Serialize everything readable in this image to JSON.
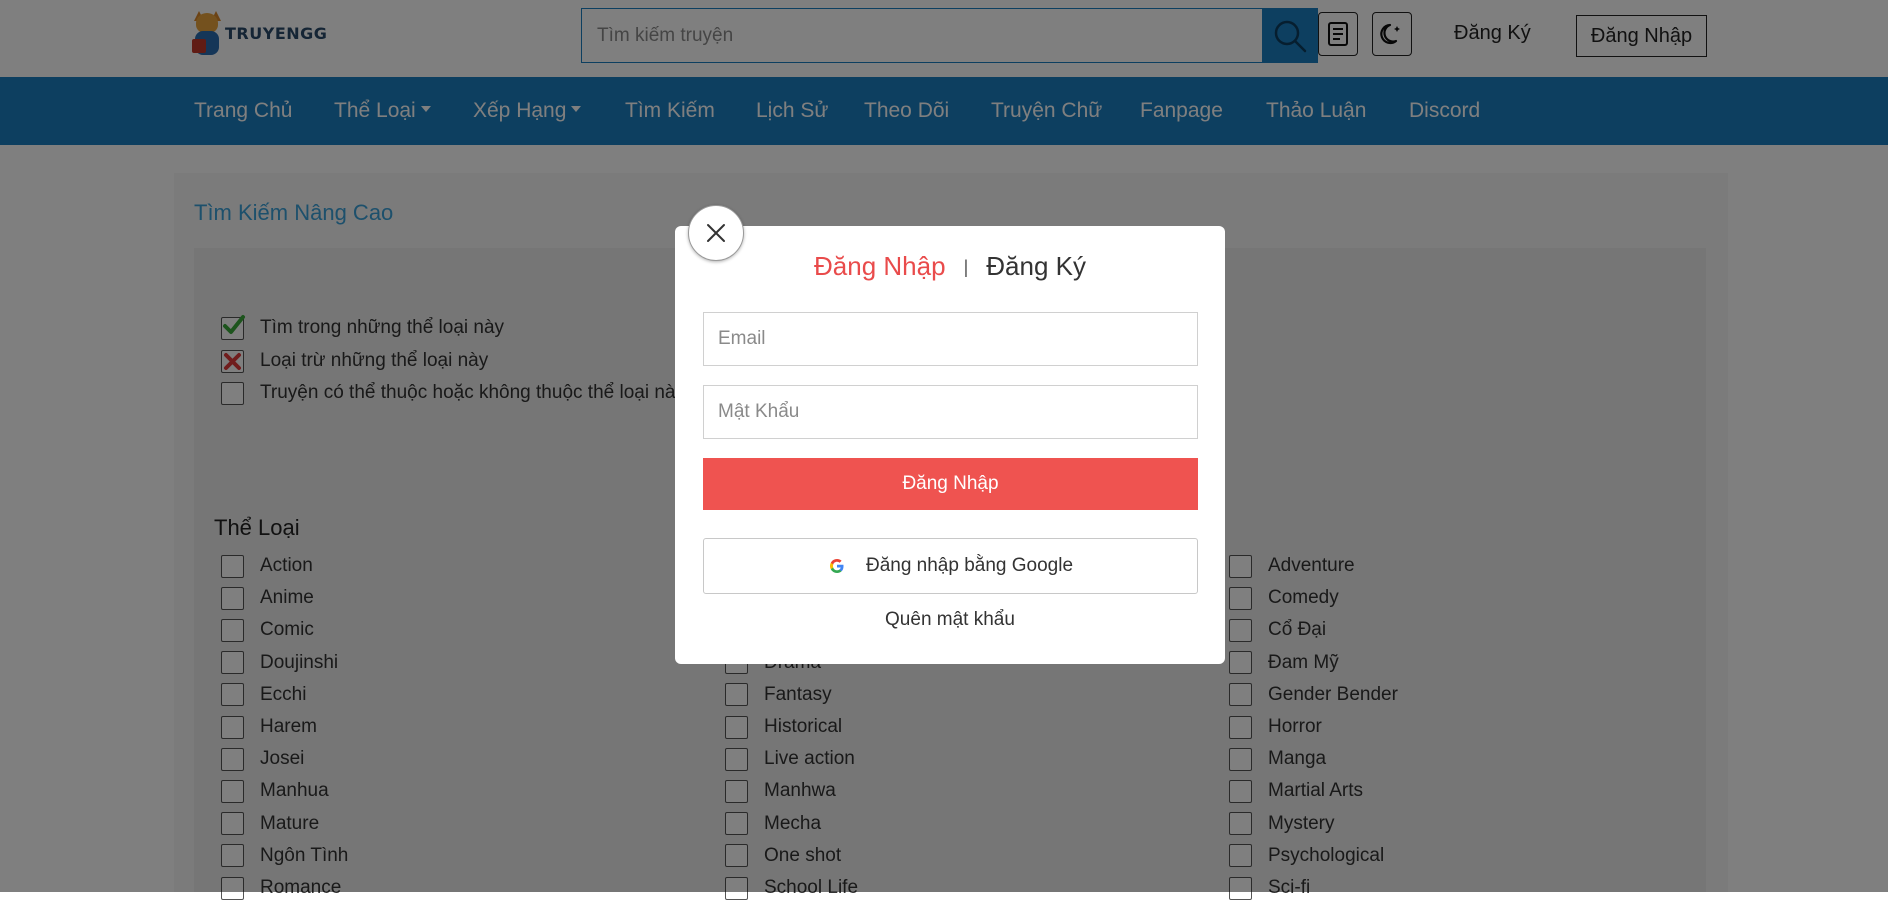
{
  "header": {
    "logo_text": "TRUYENGG",
    "search_placeholder": "Tìm kiếm truyện",
    "register_label": "Đăng Ký",
    "login_label": "Đăng Nhập"
  },
  "nav": {
    "items": [
      "Trang Chủ",
      "Thể Loại",
      "Xếp Hạng",
      "Tìm Kiếm",
      "Lịch Sử",
      "Theo Dõi",
      "Truyện Chữ",
      "Fanpage",
      "Thảo Luận",
      "Discord"
    ]
  },
  "search_page": {
    "title": "Tìm Kiếm Nâng Cao",
    "legend": [
      {
        "label": "Tìm trong những thể loại này",
        "state": "include"
      },
      {
        "label": "Loại trừ những thể loại này",
        "state": "exclude"
      },
      {
        "label": "Truyện có thể thuộc hoặc không thuộc thể loại này",
        "state": "none"
      }
    ],
    "genre_title": "Thể Loại",
    "genres": {
      "col1": [
        "Action",
        "Anime",
        "Comic",
        "Doujinshi",
        "Ecchi",
        "Harem",
        "Josei",
        "Manhua",
        "Mature",
        "Ngôn Tình",
        "Romance"
      ],
      "col2": [
        "",
        "",
        "",
        "Drama",
        "Fantasy",
        "Historical",
        "Live action",
        "Manhwa",
        "Mecha",
        "One shot",
        "School Life"
      ],
      "col3": [
        "Adventure",
        "Comedy",
        "Cổ Đại",
        "Đam Mỹ",
        "Gender Bender",
        "Horror",
        "Manga",
        "Martial Arts",
        "Mystery",
        "Psychological",
        "Sci-fi"
      ]
    }
  },
  "modal": {
    "tab_login": "Đăng Nhập",
    "separator": "|",
    "tab_register": "Đăng Ký",
    "email_placeholder": "Email",
    "password_placeholder": "Mật Khẩu",
    "submit_label": "Đăng Nhập",
    "google_label": "Đăng nhập bằng Google",
    "forgot_label": "Quên mật khẩu"
  },
  "colors": {
    "brand_blue": "#1a7fc1",
    "accent_red": "#ef5350",
    "link_blue": "#3aa0d8"
  }
}
